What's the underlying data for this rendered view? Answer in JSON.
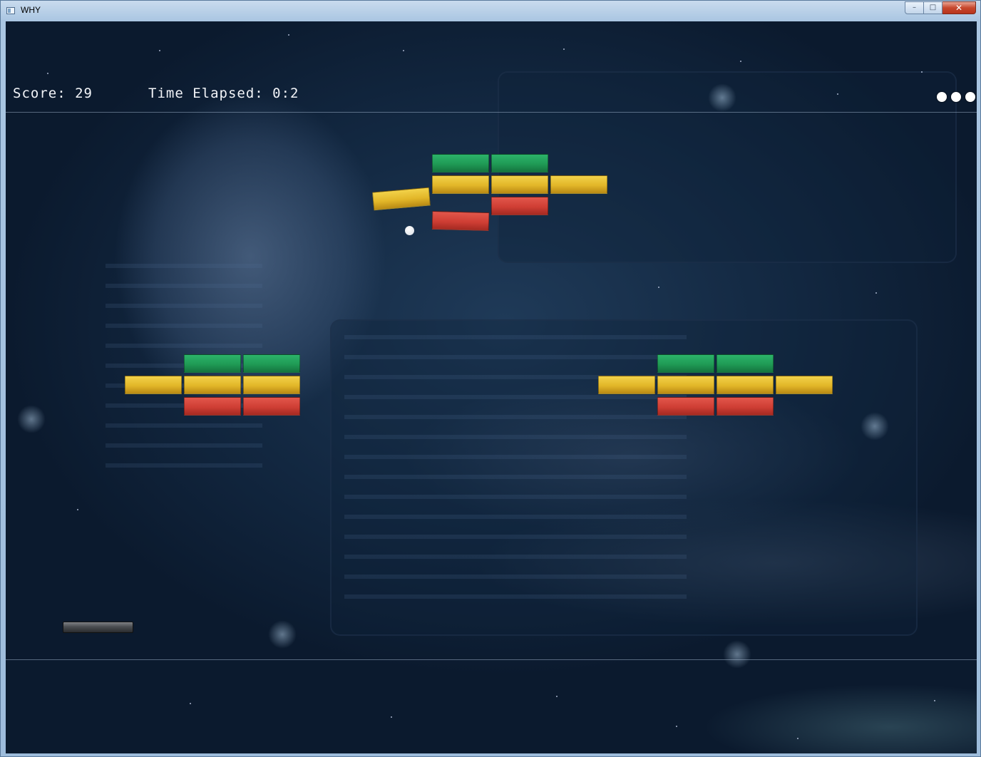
{
  "window": {
    "title": "WHY",
    "minimize_glyph": "–",
    "maximize_glyph": "□",
    "close_glyph": "✕"
  },
  "hud": {
    "score_text": "Score: 29",
    "time_text": "Time Elapsed: 0:2",
    "lives": 3
  },
  "colors": {
    "green": "#1f9a55",
    "yellow": "#e2b628",
    "red": "#cf3e34",
    "ball": "#ffffff",
    "paddle": "#4a4d51"
  },
  "bricks": [
    {
      "group": "top",
      "color": "green"
    },
    {
      "group": "top",
      "color": "green"
    },
    {
      "group": "top",
      "color": "yellow"
    },
    {
      "group": "top",
      "color": "yellow"
    },
    {
      "group": "top",
      "color": "yellow"
    },
    {
      "group": "top",
      "color": "red"
    },
    {
      "group": "top",
      "color": "red",
      "falling": true
    },
    {
      "group": "top",
      "color": "yellow",
      "falling": true
    },
    {
      "group": "left",
      "color": "green"
    },
    {
      "group": "left",
      "color": "green"
    },
    {
      "group": "left",
      "color": "yellow"
    },
    {
      "group": "left",
      "color": "yellow"
    },
    {
      "group": "left",
      "color": "yellow"
    },
    {
      "group": "left",
      "color": "red"
    },
    {
      "group": "left",
      "color": "red"
    },
    {
      "group": "right",
      "color": "green"
    },
    {
      "group": "right",
      "color": "green"
    },
    {
      "group": "right",
      "color": "yellow"
    },
    {
      "group": "right",
      "color": "yellow"
    },
    {
      "group": "right",
      "color": "yellow"
    },
    {
      "group": "right",
      "color": "yellow"
    },
    {
      "group": "right",
      "color": "red"
    },
    {
      "group": "right",
      "color": "red"
    }
  ]
}
